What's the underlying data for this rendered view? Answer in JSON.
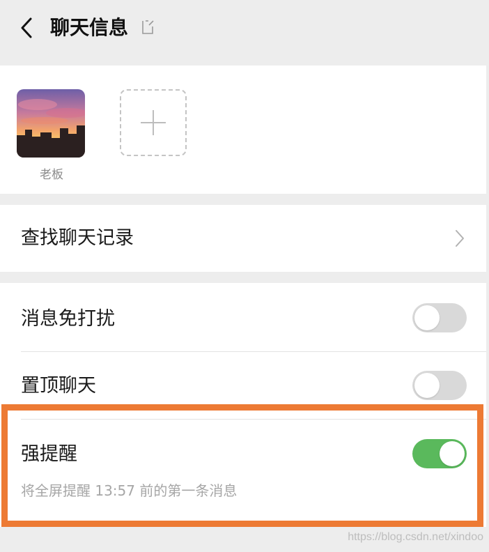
{
  "header": {
    "title": "聊天信息",
    "back_icon": "chevron-left-icon",
    "edit_icon": "edit-icon"
  },
  "members": [
    {
      "name": "老板",
      "avatar": "sunset-photo"
    }
  ],
  "add_member_icon": "plus-icon",
  "search_history": {
    "label": "查找聊天记录",
    "icon": "chevron-right-icon"
  },
  "settings": {
    "mute": {
      "label": "消息免打扰",
      "on": false
    },
    "pin": {
      "label": "置顶聊天",
      "on": false
    },
    "strong_reminder": {
      "label": "强提醒",
      "on": true,
      "subtext": "将全屏提醒 13:57 前的第一条消息"
    }
  },
  "colors": {
    "toggle_on": "#5ab95c",
    "toggle_off": "#d9d9d9",
    "highlight": "#ed7a34",
    "background": "#ededed"
  },
  "watermark": "https://blog.csdn.net/xindoo"
}
